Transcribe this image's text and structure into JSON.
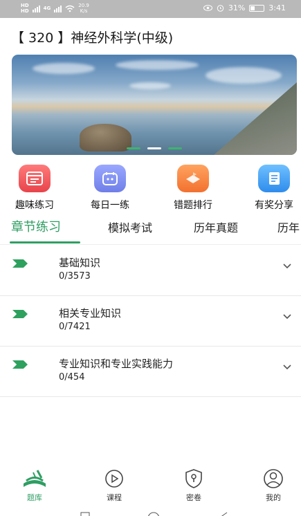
{
  "status_bar": {
    "sim_label": "HD\nHD",
    "net_label": "4G",
    "speed": "20.9",
    "speed_unit": "K/s",
    "battery": "31%",
    "time": "3:41"
  },
  "header": {
    "title": "【 320 】神经外科学(中级)"
  },
  "banner": {
    "dot_count": 3,
    "active_dot": 1
  },
  "features": [
    {
      "label": "趣味练习",
      "icon": "quiz-icon",
      "color": "#f0565a"
    },
    {
      "label": "每日一练",
      "icon": "daily-icon",
      "color": "#7c8ff0"
    },
    {
      "label": "错题排行",
      "icon": "ranking-icon",
      "color": "#f6873f"
    },
    {
      "label": "有奖分享",
      "icon": "share-icon",
      "color": "#3d9af0"
    }
  ],
  "tabs": [
    {
      "label": "章节练习",
      "active": true
    },
    {
      "label": "模拟考试",
      "active": false
    },
    {
      "label": "历年真题",
      "active": false
    },
    {
      "label": "历年",
      "active": false
    }
  ],
  "chapters": [
    {
      "name": "基础知识",
      "progress": "0/3573"
    },
    {
      "name": "相关专业知识",
      "progress": "0/7421"
    },
    {
      "name": "专业知识和专业实践能力",
      "progress": "0/454"
    }
  ],
  "bottom_nav": [
    {
      "label": "题库",
      "icon": "question-bank-icon",
      "active": true
    },
    {
      "label": "课程",
      "icon": "play-icon",
      "active": false
    },
    {
      "label": "密卷",
      "icon": "lock-shield-icon",
      "active": false
    },
    {
      "label": "我的",
      "icon": "user-icon",
      "active": false
    }
  ],
  "colors": {
    "accent": "#2f9e63",
    "status_bar": "#b9b9b9"
  }
}
